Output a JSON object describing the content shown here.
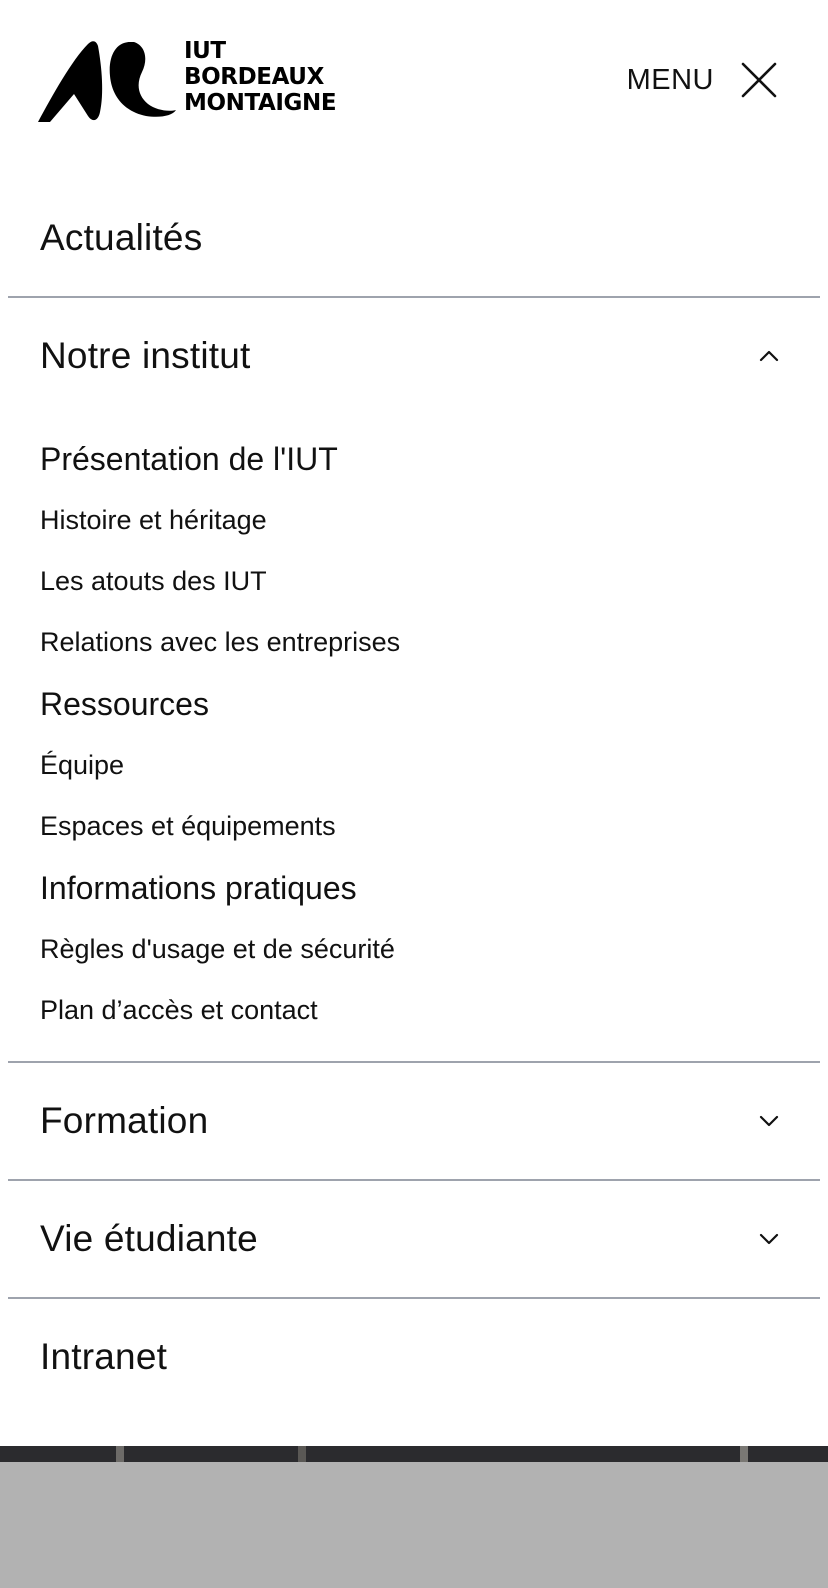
{
  "header": {
    "logo": {
      "line1": "IUT",
      "line2": "BORDEAUX",
      "line3": "MONTAIGNE"
    },
    "menu_label": "MENU",
    "close_icon": "close-icon"
  },
  "nav": {
    "actualites": {
      "label": "Actualités"
    },
    "institut": {
      "label": "Notre institut",
      "expanded": true,
      "groups": [
        {
          "heading": "Présentation de l'IUT",
          "links": [
            "Histoire et héritage",
            "Les atouts des IUT",
            "Relations avec les entreprises"
          ]
        },
        {
          "heading": "Ressources",
          "links": [
            "Équipe",
            "Espaces et équipements"
          ]
        },
        {
          "heading": "Informations pratiques",
          "links": [
            "Règles d'usage et de sécurité",
            "Plan d’accès et contact"
          ]
        }
      ]
    },
    "formation": {
      "label": "Formation",
      "expanded": false
    },
    "vie_etudiante": {
      "label": "Vie étudiante",
      "expanded": false
    },
    "intranet": {
      "label": "Intranet"
    }
  },
  "colors": {
    "divider": "#9ea3ad",
    "text": "#111111",
    "overlay": "#b2b2b2"
  }
}
